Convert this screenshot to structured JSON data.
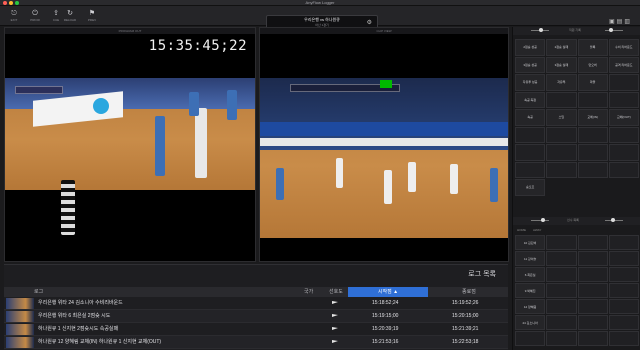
{
  "app": {
    "title": "AnyFlow Logger"
  },
  "toolbar": {
    "buttons": [
      {
        "label": "EXIT",
        "icon": "exit-icon"
      },
      {
        "label": "PRIOR",
        "icon": "power-icon"
      },
      {
        "label": "CUE",
        "icon": "upload-icon"
      },
      {
        "label": "RELOAD",
        "icon": "refresh-icon"
      },
      {
        "label": "PREV",
        "icon": "flag-icon"
      }
    ],
    "match_title": "우리은행 vs 하나원큐",
    "match_sub": "아산 1경기"
  },
  "player_left": {
    "header": "PROGRAM OUT",
    "timecode": "15:35:45;22"
  },
  "player_right": {
    "header": "CLIP VIEW"
  },
  "log": {
    "title": "로그 목록",
    "columns": {
      "log": "로그",
      "nation": "국가",
      "important": "선호도",
      "start": "시작점",
      "end": "종료점"
    },
    "rows": [
      {
        "text": "우리은행 위타 24 김소니아 수비리바운드",
        "start": "15:18:52;24",
        "end": "15:19:52;26"
      },
      {
        "text": "우리은행 위타 6 최은실 2점슛 시도",
        "start": "15:19:15;00",
        "end": "15:20:15;00"
      },
      {
        "text": "하나원큐 1 신지현 2점슛시도 속공실패",
        "start": "15:20:39;19",
        "end": "15:21:39;21"
      },
      {
        "text": "하나원큐 12 양혜림 교체(IN) 하나원큐 1 신지현 교체(OUT)",
        "start": "15:21:53;16",
        "end": "15:22:53;18"
      }
    ]
  },
  "side": {
    "top_label": "직원 기록",
    "upper_cells": [
      "2점슛 성공",
      "2점슛 실패",
      "블록",
      "수비 리바운드",
      "3점슛 성공",
      "3점슛 실패",
      "턴오버",
      "공격 리바운드",
      "자유투 성공",
      "자유투",
      "파울",
      "",
      "속공 득점",
      "",
      "",
      "",
      "속공",
      "스틸",
      "교체(IN)",
      "교체(OUT)",
      "",
      "",
      "",
      "",
      "",
      "",
      "",
      "",
      "",
      "",
      "",
      "",
      "슛오프"
    ],
    "lower_label": "선수 목록",
    "tabs": [
      "HOME",
      "AWAY"
    ],
    "lower_cells": [
      "10 김단비",
      "",
      "",
      "",
      "11 강이슬",
      "",
      "",
      "",
      "6 최은실",
      "",
      "",
      "",
      "9 박혜진",
      "",
      "",
      "",
      "12 양혜림",
      "",
      "",
      "",
      "24 김소니아",
      "",
      "",
      "",
      "",
      "",
      "",
      ""
    ]
  },
  "colors": {
    "accent": "#2f6fd6",
    "background": "#1b1b1d"
  }
}
